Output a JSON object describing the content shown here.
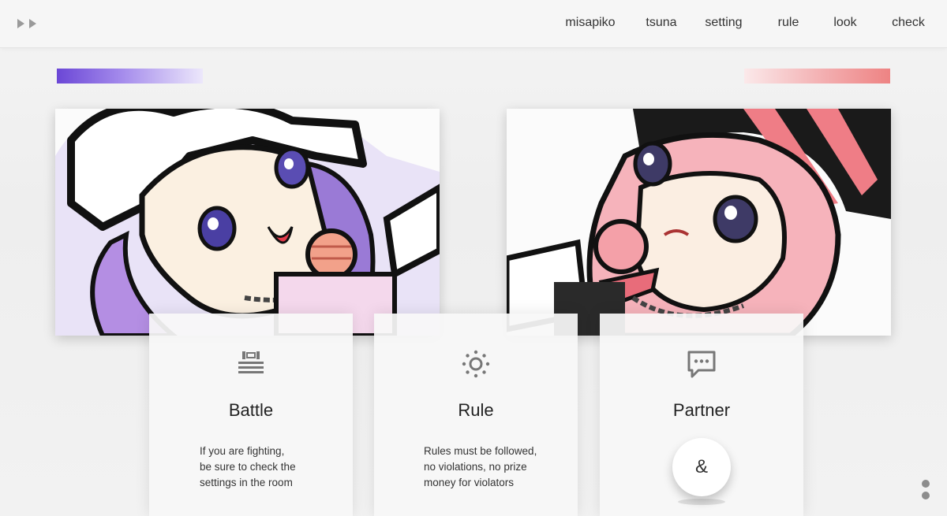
{
  "header": {
    "play_icons": [
      "play-icon",
      "play-icon"
    ],
    "nav": [
      "misapiko",
      "tsuna",
      "setting",
      "rule",
      "look",
      "check"
    ]
  },
  "accents": {
    "left_bar": "#6b47d6",
    "right_bar": "#ee8383"
  },
  "heroes": [
    {
      "name": "purple-haired-character-illustration",
      "palette": "#a58cec"
    },
    {
      "name": "pink-haired-character-illustration",
      "palette": "#f3a0a8"
    }
  ],
  "cards": [
    {
      "icon": "stack-lines-icon",
      "title": "Battle",
      "text_lines": [
        "If you are fighting,",
        "be sure to check the",
        "settings in the room"
      ]
    },
    {
      "icon": "sun-icon",
      "title": "Rule",
      "text_lines": [
        "Rules must be followed,",
        "no violations, no prize",
        "money for violators"
      ]
    },
    {
      "icon": "chat-bubble-icon",
      "title": "Partner",
      "button_label": "&"
    }
  ],
  "more_menu_icon": "vertical-dots-icon"
}
